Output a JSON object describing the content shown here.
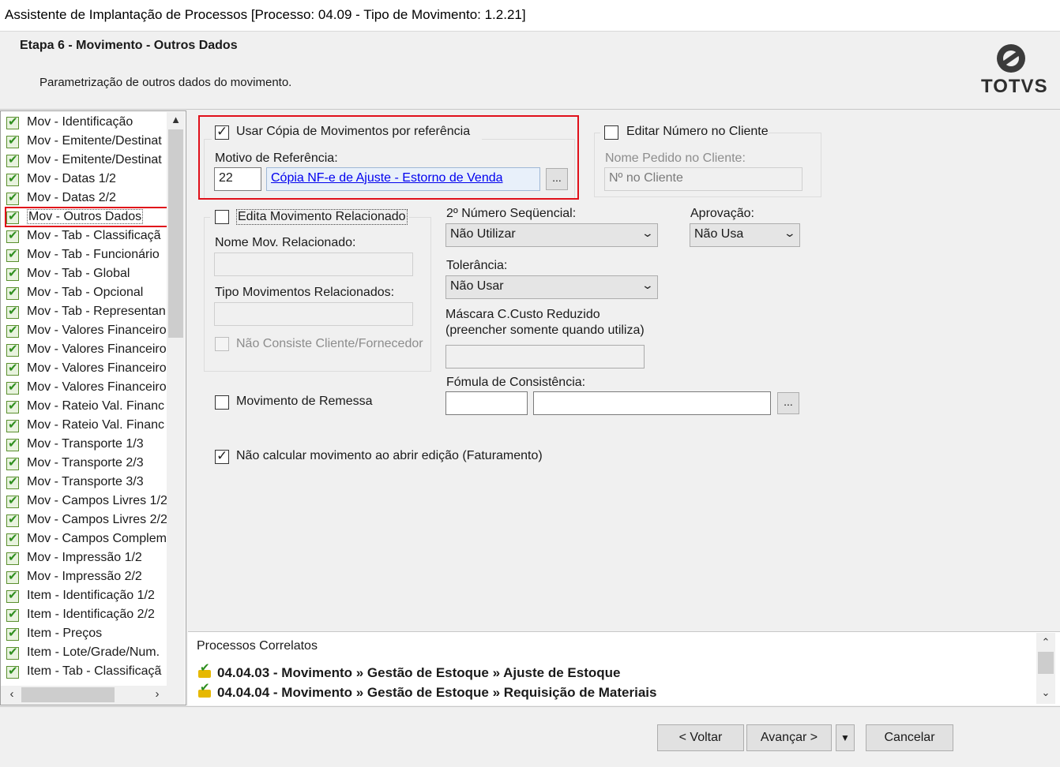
{
  "window": {
    "title": "Assistente de Implantação de Processos [Processo: 04.09 - Tipo de Movimento: 1.2.21]"
  },
  "header": {
    "step_title": "Etapa 6 - Movimento - Outros Dados",
    "step_description": "Parametrização de outros dados do movimento.",
    "logo_text": "TOTVS"
  },
  "tree": {
    "items": [
      "Mov - Identificação",
      "Mov - Emitente/Destinat",
      "Mov - Emitente/Destinat",
      "Mov - Datas 1/2",
      "Mov - Datas 2/2",
      "Mov - Outros Dados",
      "Mov - Tab - Classificaçã",
      "Mov - Tab - Funcionário",
      "Mov - Tab - Global",
      "Mov - Tab - Opcional",
      "Mov - Tab - Representan",
      "Mov - Valores Financeiro",
      "Mov - Valores Financeiro",
      "Mov - Valores Financeiro",
      "Mov - Valores Financeiro",
      "Mov - Rateio Val. Financ",
      "Mov - Rateio Val. Financ",
      "Mov - Transporte 1/3",
      "Mov - Transporte 2/3",
      "Mov - Transporte 3/3",
      "Mov - Campos Livres 1/2",
      "Mov - Campos Livres 2/2",
      "Mov - Campos Compleme",
      "Mov - Impressão 1/2",
      "Mov - Impressão 2/2",
      "Item - Identificação 1/2",
      "Item - Identificação 2/2",
      "Item - Preços",
      "Item - Lote/Grade/Num.",
      "Item - Tab - Classificaçã"
    ],
    "selected_index": 5
  },
  "form": {
    "usar_copia": {
      "label": "Usar Cópia de Movimentos por referência",
      "checked": true
    },
    "motivo_label": "Motivo de Referência:",
    "motivo_code": "22",
    "motivo_desc": "Cópia NF-e de Ajuste - Estorno de Venda",
    "lookup_btn": "...",
    "editar_numero": {
      "label": "Editar Número no Cliente",
      "checked": false
    },
    "nome_pedido_label": "Nome Pedido no Cliente:",
    "nome_pedido_value": "Nº no Cliente",
    "edita_mov_rel": {
      "label": "Edita Movimento Relacionado",
      "checked": false
    },
    "nome_mov_rel_label": "Nome Mov. Relacionado:",
    "tipo_mov_rel_label": "Tipo Movimentos Relacionados:",
    "nao_consiste": {
      "label": "Não Consiste Cliente/Fornecedor",
      "checked": false
    },
    "segundo_numero_label": "2º Número Seqüencial:",
    "segundo_numero_value": "Não Utilizar",
    "aprovacao_label": "Aprovação:",
    "aprovacao_value": "Não Usa",
    "tolerancia_label": "Tolerância:",
    "tolerancia_value": "Não Usar",
    "mascara_label_1": "Máscara C.Custo Reduzido",
    "mascara_label_2": "(preencher somente quando utiliza)",
    "movimento_remessa": {
      "label": "Movimento de Remessa",
      "checked": false
    },
    "formula_label": "Fómula de Consistência:",
    "nao_calcular": {
      "label": "Não calcular movimento ao abrir edição (Faturamento)",
      "checked": true
    }
  },
  "correlatos": {
    "title": "Processos Correlatos",
    "items": [
      "04.04.03 - Movimento » Gestão de Estoque » Ajuste de Estoque",
      "04.04.04 - Movimento » Gestão de Estoque » Requisição de Materiais"
    ]
  },
  "footer": {
    "voltar": "< Voltar",
    "avancar": "Avançar >",
    "cancelar": "Cancelar"
  }
}
